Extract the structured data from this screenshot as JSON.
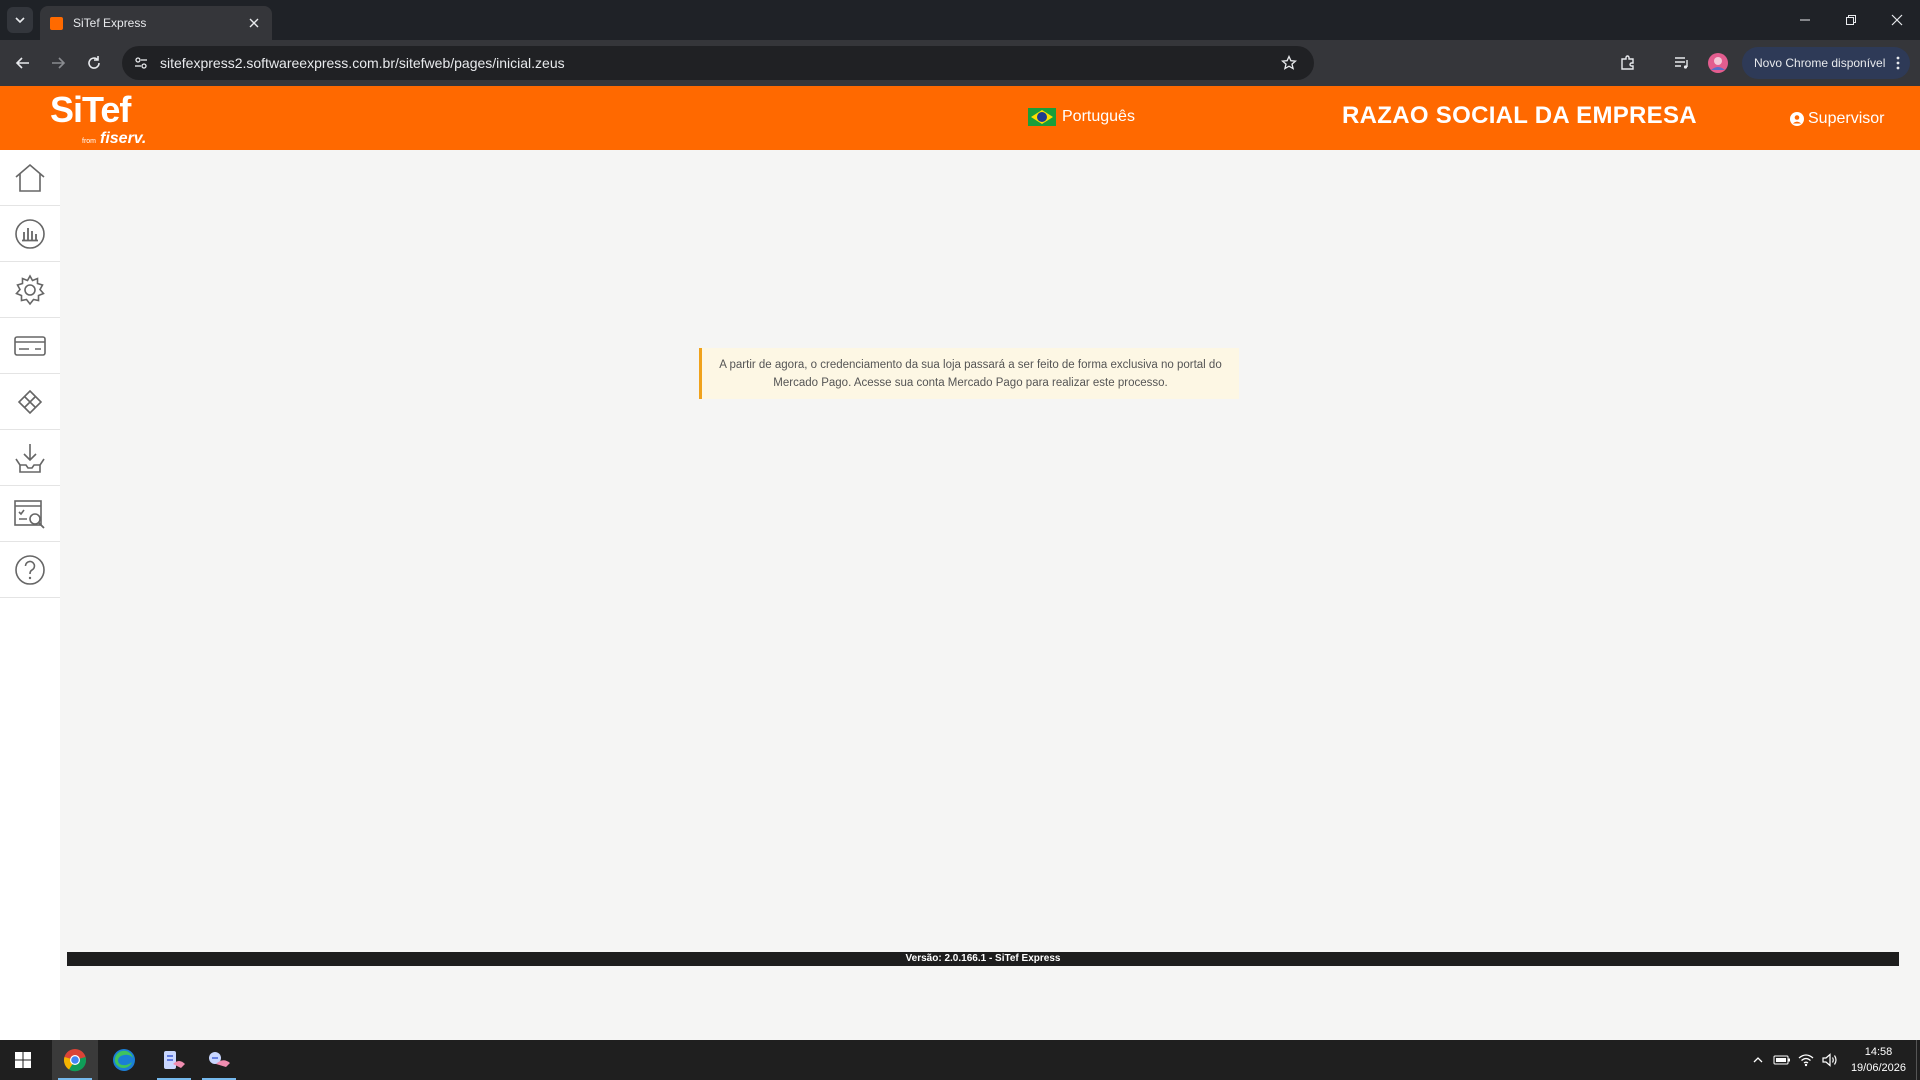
{
  "browser": {
    "tab_title": "SiTef Express",
    "url": "sitefexpress2.softwareexpress.com.br/sitefweb/pages/inicial.zeus",
    "update_label": "Novo Chrome disponível"
  },
  "header": {
    "logo_main": "SiTef",
    "logo_from": "from",
    "logo_brand": "fiserv.",
    "language": "Português",
    "company": "RAZAO SOCIAL DA EMPRESA",
    "user": "Supervisor"
  },
  "sidebar": {
    "items": [
      {
        "icon": "home-icon"
      },
      {
        "icon": "chart-icon"
      },
      {
        "icon": "gear-icon"
      },
      {
        "icon": "card-icon"
      },
      {
        "icon": "diamond-icon"
      },
      {
        "icon": "download-tray-icon"
      },
      {
        "icon": "report-search-icon"
      },
      {
        "icon": "help-icon"
      }
    ]
  },
  "main": {
    "alert_text": "A partir de agora, o credenciamento da sua loja passará a ser feito de forma exclusiva no portal do Mercado Pago. Acesse sua conta Mercado Pago para realizar este processo.",
    "footer": "Versão: 2.0.166.1 - SiTef Express"
  },
  "taskbar": {
    "time": "14:58",
    "date": "19/06/2026"
  },
  "colors": {
    "brand_orange": "#ff6900",
    "alert_border": "#f0a21b",
    "alert_bg": "#fdf7e4"
  }
}
